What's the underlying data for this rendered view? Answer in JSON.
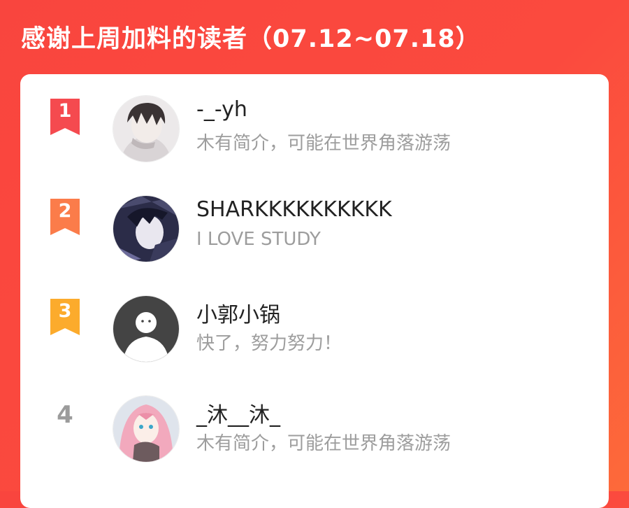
{
  "header": {
    "title": "感谢上周加料的读者（07.12~07.18）"
  },
  "colors": {
    "background": "#f9453e",
    "rank1": "#f54a4f",
    "rank2": "#fb7c4a",
    "rank3": "#fcab2c",
    "rank_plain": "#9b9b9b"
  },
  "readers": [
    {
      "rank": "1",
      "name": "-_-yh",
      "bio": "木有简介，可能在世界角落游荡",
      "avatar_icon": "anime-boy-avatar-icon"
    },
    {
      "rank": "2",
      "name": "SHARKKKKKKKKKK",
      "bio": "I LOVE STUDY",
      "avatar_icon": "anime-dark-avatar-icon"
    },
    {
      "rank": "3",
      "name": "小郭小锅",
      "bio": "快了，努力努力！",
      "avatar_icon": "default-user-avatar-icon"
    },
    {
      "rank": "4",
      "name": "_沐__沐_",
      "bio": "木有简介，可能在世界角落游荡",
      "avatar_icon": "anime-pink-hair-avatar-icon"
    }
  ]
}
